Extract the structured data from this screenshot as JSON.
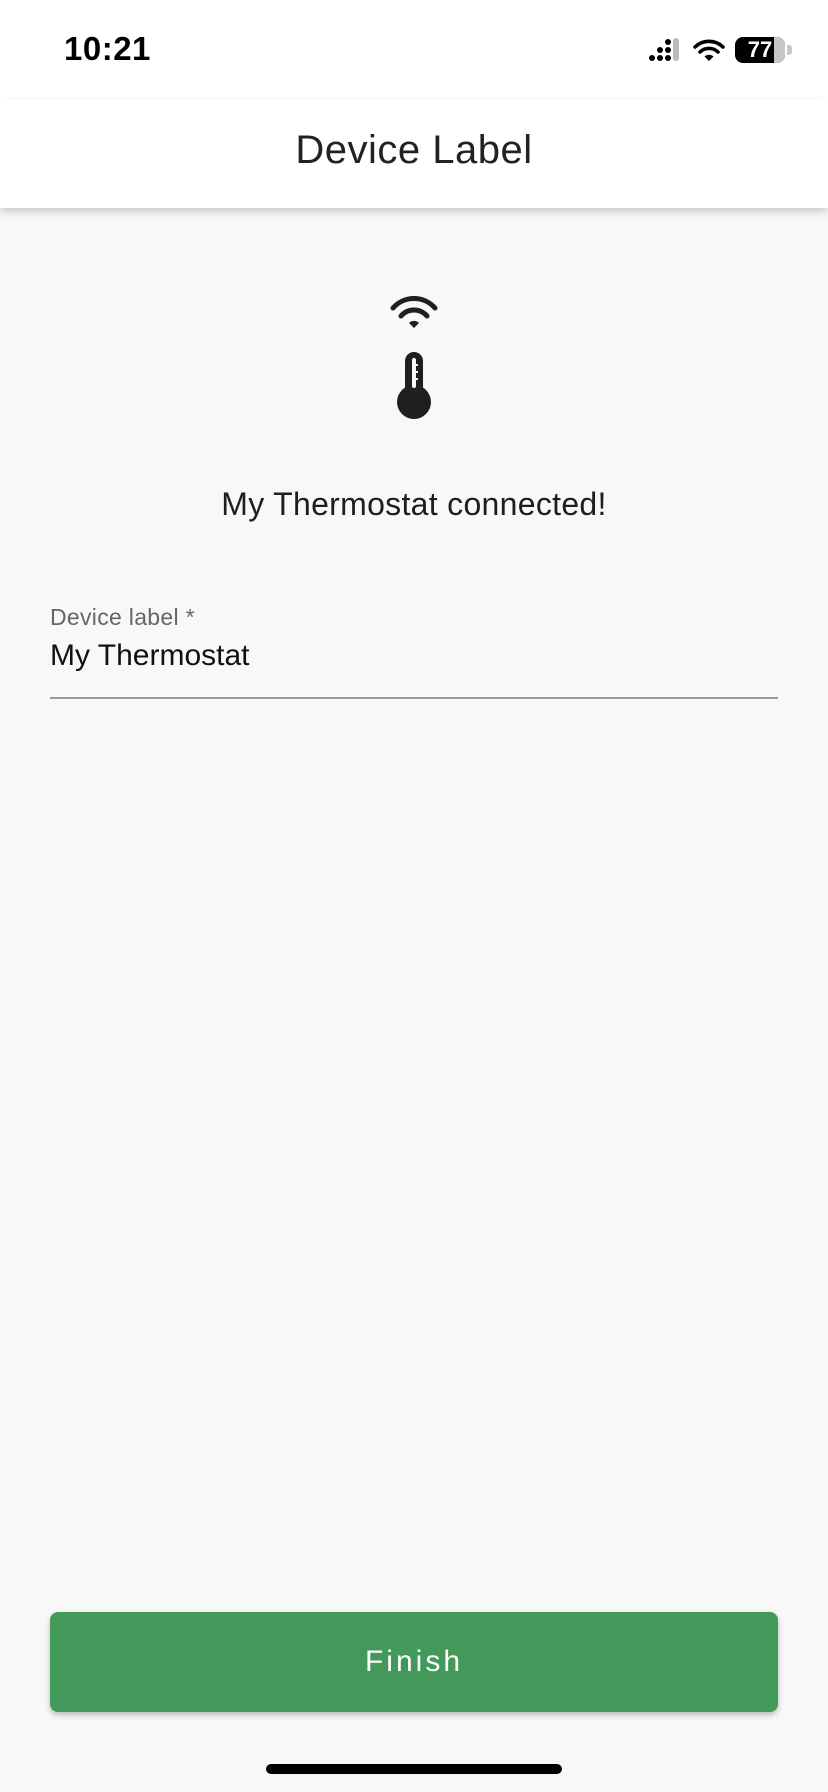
{
  "status_bar": {
    "time": "10:21",
    "battery": "77",
    "icons": [
      "cellular-signal-icon",
      "wifi-icon",
      "battery-icon"
    ]
  },
  "header": {
    "title": "Device Label"
  },
  "main": {
    "icons": [
      "wifi-icon",
      "thermometer-icon"
    ],
    "status_message": "My Thermostat connected!",
    "label_field": {
      "label": "Device label *",
      "value": "My Thermostat"
    }
  },
  "footer": {
    "finish_label": "Finish"
  },
  "colors": {
    "accent": "#43995a",
    "background": "#f8f8f8"
  }
}
